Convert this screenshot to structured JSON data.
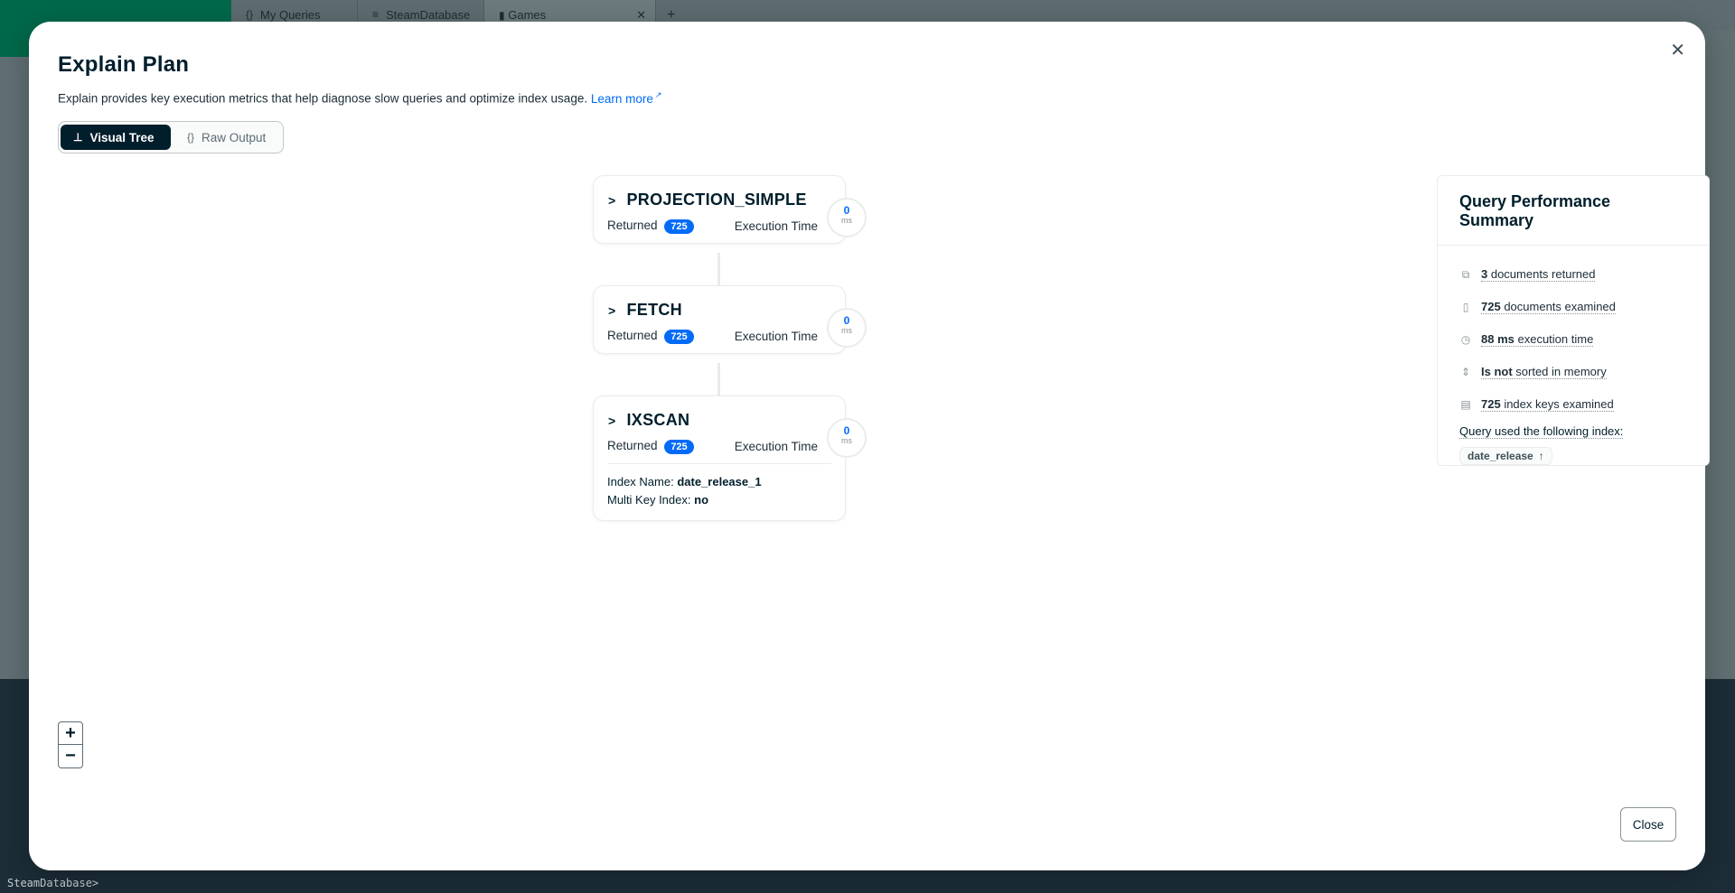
{
  "background": {
    "tabs": [
      {
        "icon": "{}",
        "label": "My Queries"
      },
      {
        "icon": "≡",
        "label": "SteamDatabase"
      },
      {
        "icon": "▮",
        "label": "Games"
      }
    ],
    "shell_prompt": "SteamDatabase>"
  },
  "modal": {
    "title": "Explain Plan",
    "description": "Explain provides key execution metrics that help diagnose slow queries and optimize index usage.",
    "learn_more": "Learn more",
    "views": {
      "visual_tree": "Visual Tree",
      "raw_output": "Raw Output"
    },
    "close_label": "Close"
  },
  "stages": [
    {
      "name": "PROJECTION_SIMPLE",
      "returned_label": "Returned",
      "returned": "725",
      "exec_label": "Execution Time",
      "time": "0",
      "unit": "ms"
    },
    {
      "name": "FETCH",
      "returned_label": "Returned",
      "returned": "725",
      "exec_label": "Execution Time",
      "time": "0",
      "unit": "ms"
    },
    {
      "name": "IXSCAN",
      "returned_label": "Returned",
      "returned": "725",
      "exec_label": "Execution Time",
      "time": "0",
      "unit": "ms",
      "index_name_label": "Index Name:",
      "index_name": "date_release_1",
      "multikey_label": "Multi Key Index:",
      "multikey": "no"
    }
  ],
  "summary": {
    "title": "Query Performance Summary",
    "items": [
      {
        "icon": "docs-icon",
        "value": "3",
        "text": " documents returned"
      },
      {
        "icon": "doc-icon",
        "value": "725",
        "text": " documents examined"
      },
      {
        "icon": "clock-icon",
        "value": "88 ms",
        "text": " execution time"
      },
      {
        "icon": "sort-icon",
        "value": "Is not",
        "text": " sorted in memory"
      },
      {
        "icon": "index-icon",
        "value": "725",
        "text": " index keys examined"
      }
    ],
    "index_label": "Query used the following index:",
    "index_chip": "date_release",
    "index_direction": "↑"
  },
  "zoom": {
    "in": "+",
    "out": "−"
  }
}
